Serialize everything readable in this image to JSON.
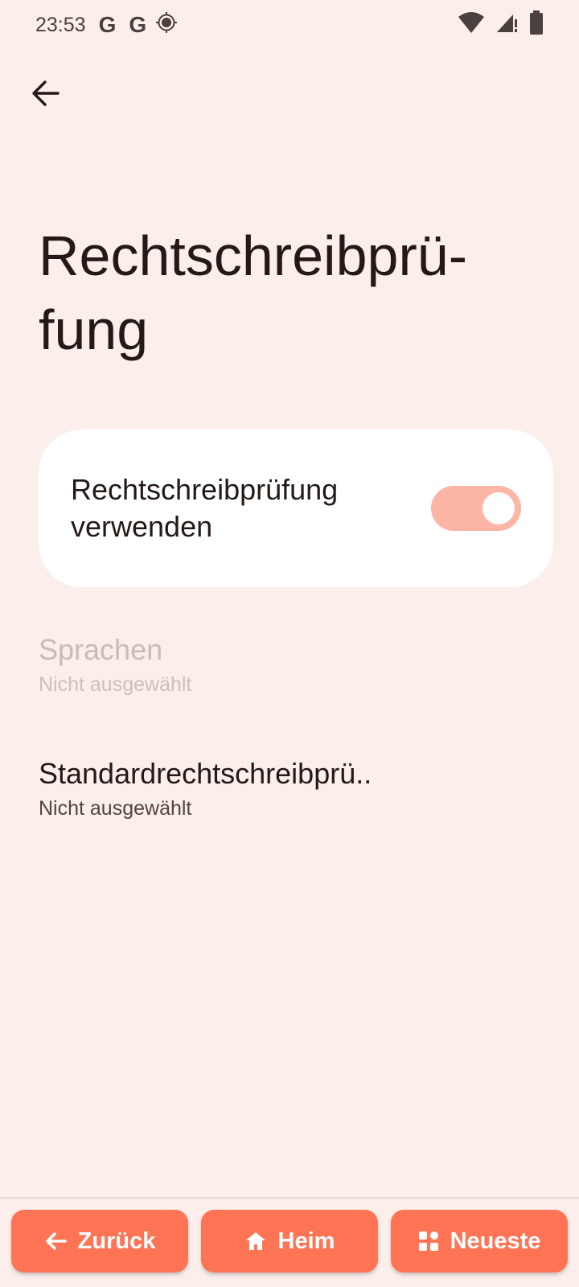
{
  "status_bar": {
    "time": "23:53",
    "icons": [
      "google-g-icon",
      "google-g-icon",
      "location-icon",
      "wifi-icon",
      "signal-icon",
      "battery-icon"
    ],
    "g1": "G",
    "g2": "G"
  },
  "header": {
    "back_icon": "arrow-left-icon",
    "title": "Rechtschreibprü-\nfung"
  },
  "toggle_card": {
    "label": "Rechtschreibprüfung verwenden",
    "enabled": true,
    "track_color": "#fdb5a5"
  },
  "preferences": [
    {
      "title": "Sprachen",
      "summary": "Nicht ausgewählt",
      "disabled": true
    },
    {
      "title": "Standardrechtschreibprü..",
      "summary": "Nicht ausgewählt",
      "disabled": false
    }
  ],
  "bottom_nav": {
    "back_label": "Zurück",
    "home_label": "Heim",
    "recent_label": "Neueste",
    "accent": "#ff7454"
  }
}
